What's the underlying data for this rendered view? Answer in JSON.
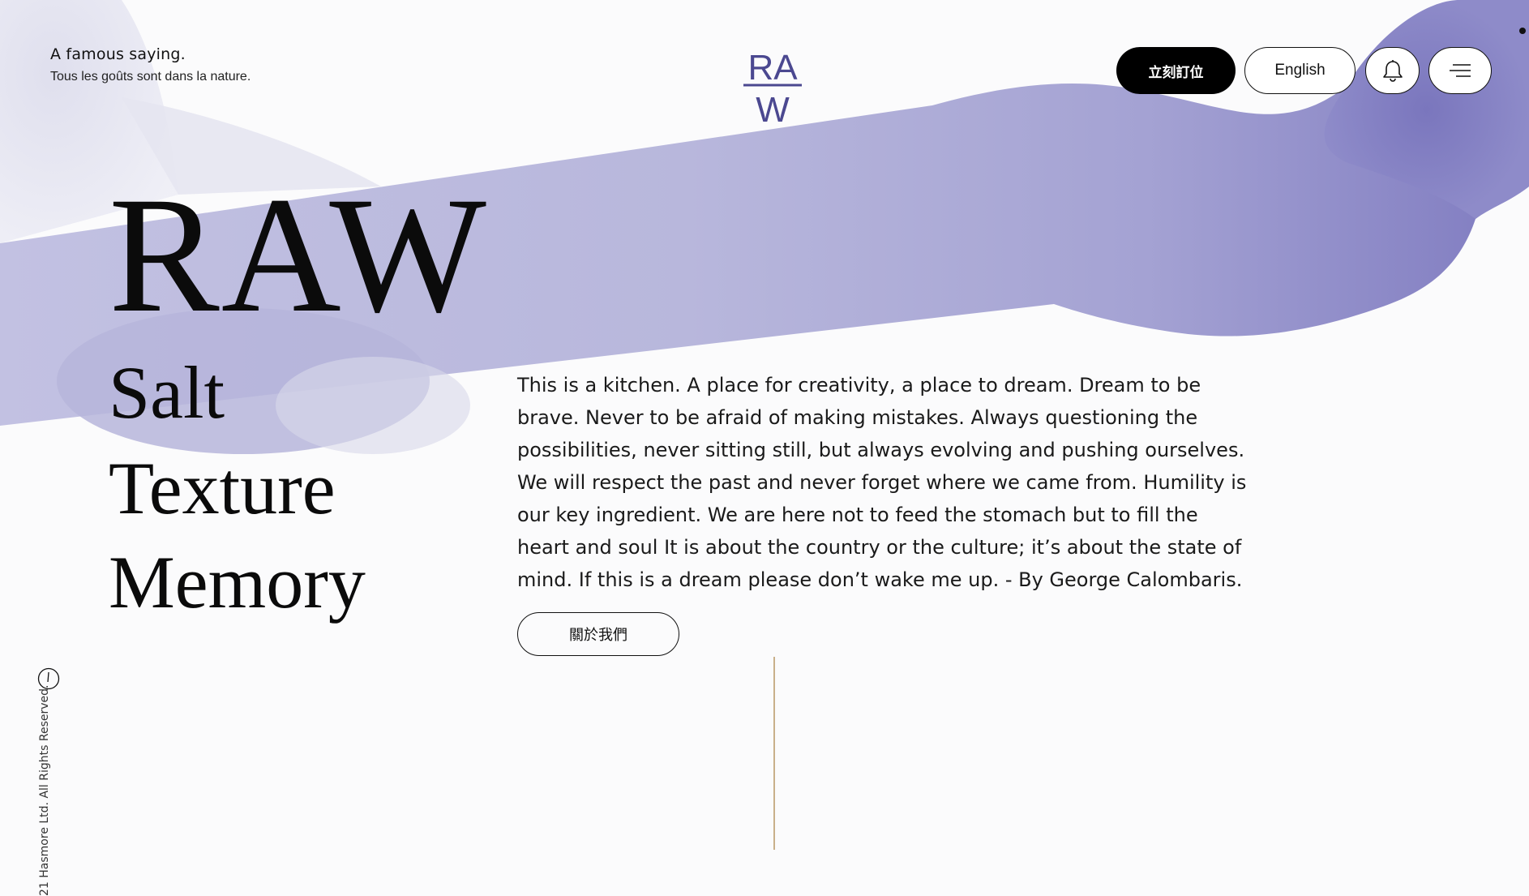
{
  "header": {
    "saying_title": "A famous saying.",
    "saying_subtitle": "Tous les goûts sont dans la nature.",
    "logo_text_top": "RA",
    "logo_text_bottom": "W",
    "book_button": "立刻訂位",
    "language_button": "English",
    "bell_icon": "bell-icon",
    "menu_icon": "hamburger-menu-icon"
  },
  "hero": {
    "title": "RAW",
    "words": [
      "Salt",
      "Texture",
      "Memory"
    ]
  },
  "about": {
    "text": "This is a kitchen. A place for creativity, a place to dream. Dream to be brave. Never to be afraid of making mistakes. Always questioning the possibilities, never sitting still, but always evolving and pushing ourselves. We will respect the past and never forget where we came from. Humility is our key ingredient. We are here not to feed the stomach but to fill the heart and soul It is about the country or the culture; it’s about the state of mind. If this is a dream please don’t wake me up. - By George Calombaris.",
    "button": "關於我們"
  },
  "sidebar": {
    "clock_icon": "clock-icon",
    "copyright": "21 Hasmore Ltd. All Rights Reserved."
  },
  "colors": {
    "accent_lavender": "#b9b8dd",
    "accent_purple": "#7f7bc0",
    "divider_gold": "#c9b08a",
    "logo_color": "#4b4890"
  }
}
